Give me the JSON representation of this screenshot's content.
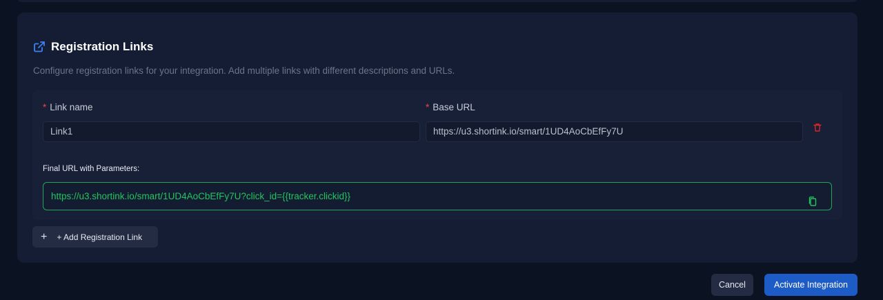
{
  "section": {
    "title": "Registration Links",
    "description": "Configure registration links for your integration. Add multiple links with different descriptions and URLs.",
    "title_icon": "external-link-icon"
  },
  "link": {
    "name_label": "Link name",
    "name_value": "Link1",
    "url_label": "Base URL",
    "url_value": "https://u3.shortink.io/smart/1UD4AoCbEfFy7U",
    "required_marker": "*",
    "final_label": "Final URL with Parameters:",
    "final_url": "https://u3.shortink.io/smart/1UD4AoCbEfFy7U?click_id={{tracker.clickid}}",
    "delete_icon": "trash-icon",
    "copy_icon": "copy-icon"
  },
  "actions": {
    "add_plus": "+",
    "add_label": "+ Add Registration Link",
    "cancel_label": "Cancel",
    "activate_label": "Activate Integration"
  },
  "colors": {
    "background": "#0b1222",
    "card": "#141d33",
    "accent_green": "#22c55e",
    "primary_blue": "#1d5cc6",
    "required_red": "#ef4444"
  }
}
